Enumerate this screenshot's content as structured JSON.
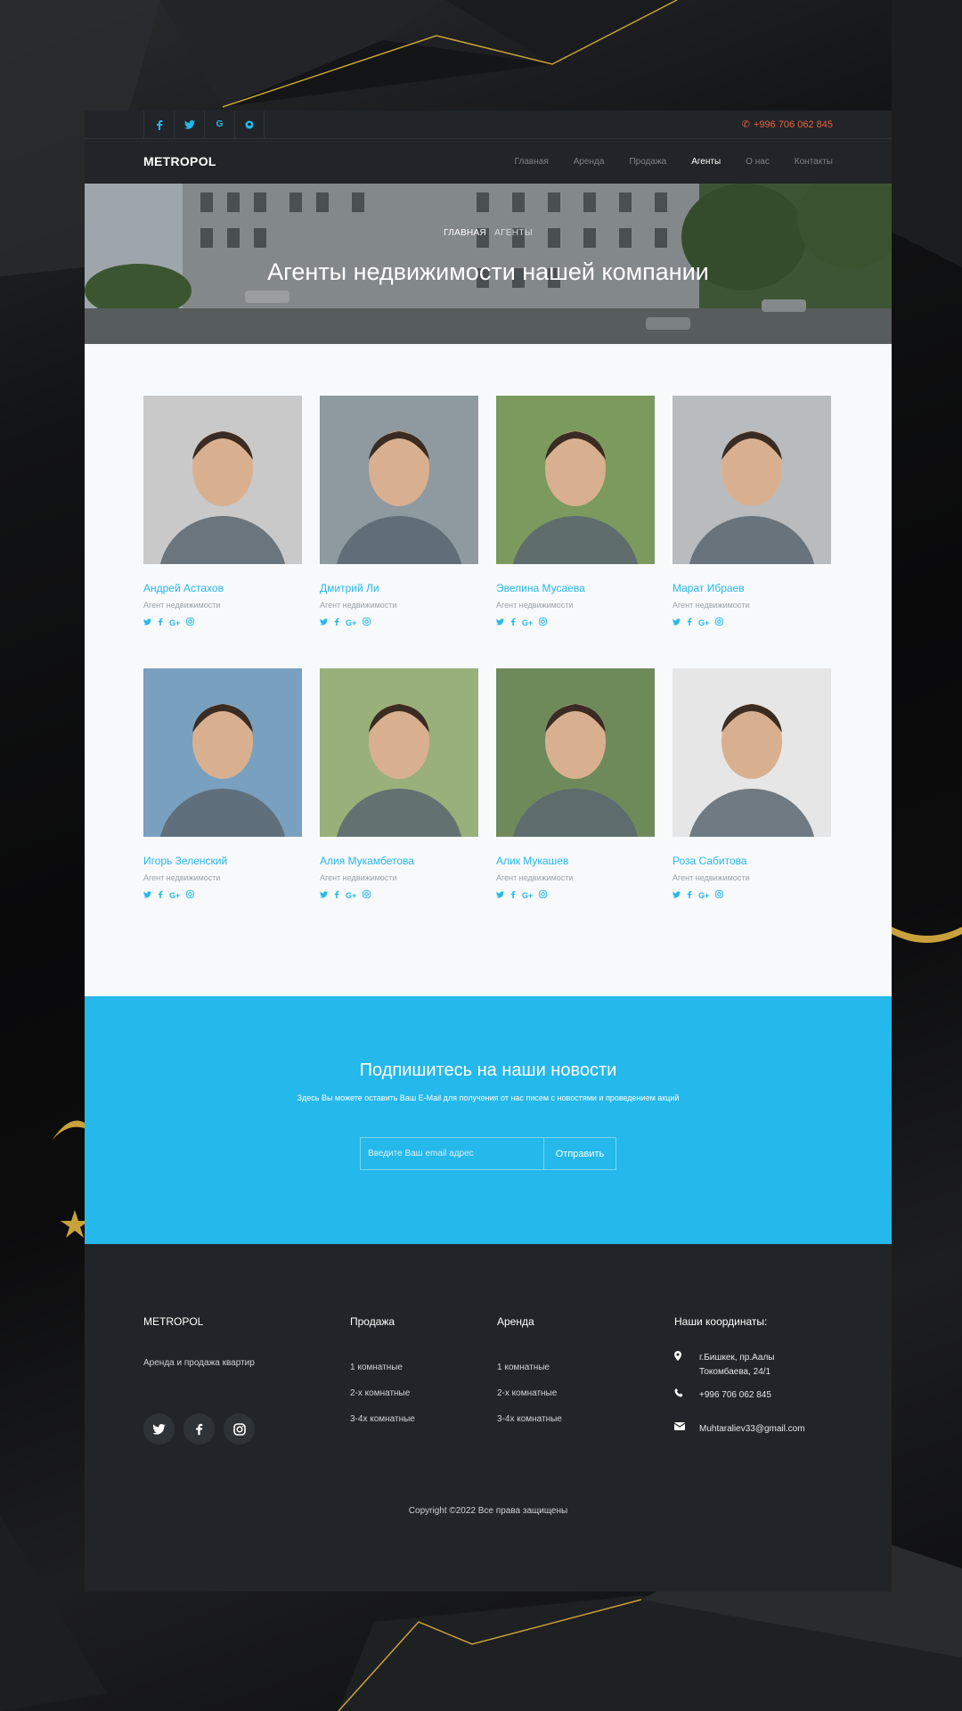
{
  "topbar": {
    "social": [
      {
        "icon": "facebook-icon",
        "glyph": "f"
      },
      {
        "icon": "twitter-icon",
        "glyph": "🐦"
      },
      {
        "icon": "google-icon",
        "glyph": "G"
      },
      {
        "icon": "pinterest-icon",
        "glyph": "⓿"
      }
    ],
    "phone": "+996 706 062 845"
  },
  "nav": {
    "logo": "METROPOL",
    "items": [
      "Главная",
      "Аренда",
      "Продажа",
      "Агенты",
      "О нас",
      "Контакты"
    ],
    "active": "Агенты"
  },
  "hero": {
    "crumb_home": "ГЛАВНАЯ",
    "crumb_current": "АГЕНТЫ",
    "title": "Агенты недвижимости нашей компании"
  },
  "agents": [
    {
      "name": "Андрей Астахов",
      "role": "Агент недвижимости",
      "tone": "#c9c9c9"
    },
    {
      "name": "Дмитрий Ли",
      "role": "Агент недвижимости",
      "tone": "#8f9aa0"
    },
    {
      "name": "Эвелина Мусаева",
      "role": "Агент недвижимости",
      "tone": "#7c9a5e"
    },
    {
      "name": "Марат Ибраев",
      "role": "Агент недвижимости",
      "tone": "#b8bcbf"
    },
    {
      "name": "Игорь Зеленский",
      "role": "Агент недвижимости",
      "tone": "#7aa0c0"
    },
    {
      "name": "Алия Мукамбетова",
      "role": "Агент недвижимости",
      "tone": "#9ab07a"
    },
    {
      "name": "Алик Мукашев",
      "role": "Агент недвижимости",
      "tone": "#6f8a5a"
    },
    {
      "name": "Роза Сабитова",
      "role": "Агент недвижимости",
      "tone": "#e6e6e6"
    }
  ],
  "subscribe": {
    "title": "Подпишитесь на наши новости",
    "text": "Здесь Вы можете оставить Ваш E-Mail для получения от нас писем с новостями и проведением акций",
    "placeholder": "Введите Ваш email адрес",
    "button": "Отправить"
  },
  "footer": {
    "brand": "METROPOL",
    "tagline": "Аренда и продажа квартир",
    "sale_title": "Продажа",
    "sale_items": [
      "1 комнатные",
      "2-х комнатные",
      "3-4х комнатные"
    ],
    "rent_title": "Аренда",
    "rent_items": [
      "1 комнатные",
      "2-х комнатные",
      "3-4х комнатные"
    ],
    "contact_title": "Наши координаты:",
    "address_line1": "г.Бишкек, пр.Аалы",
    "address_line2": "Токомбаева, 24/1",
    "phone": "+996 706 062 845",
    "email": "Muhtaraliev33@gmail.com",
    "copyright": "Copyright ©2022 Все права защищены"
  },
  "colors": {
    "accent": "#25b8ea",
    "dark": "#212529",
    "phone": "#e9603b"
  }
}
